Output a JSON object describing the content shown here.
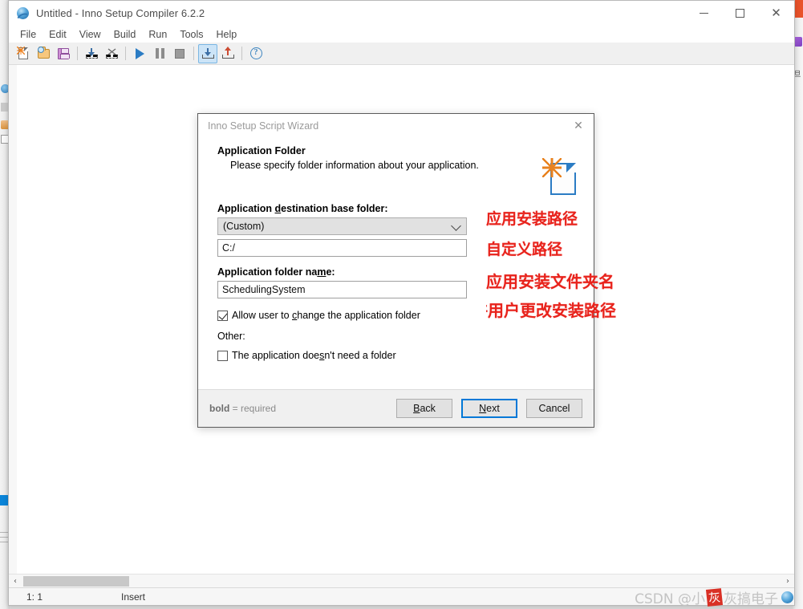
{
  "window": {
    "title": "Untitled - Inno Setup Compiler 6.2.2",
    "app_icon": "inno-setup-globe-icon",
    "minimize_label": "—",
    "maximize_label": "□",
    "close_label": "✕"
  },
  "menu": {
    "items": [
      {
        "label": "File"
      },
      {
        "label": "Edit"
      },
      {
        "label": "View"
      },
      {
        "label": "Build"
      },
      {
        "label": "Run"
      },
      {
        "label": "Tools"
      },
      {
        "label": "Help"
      }
    ]
  },
  "toolbar": {
    "buttons": [
      {
        "name": "new-file-icon"
      },
      {
        "name": "open-file-icon"
      },
      {
        "name": "save-file-icon"
      },
      {
        "name": "import-icon"
      },
      {
        "name": "close-file-icon"
      },
      {
        "name": "run-icon"
      },
      {
        "name": "pause-icon"
      },
      {
        "name": "stop-icon"
      },
      {
        "name": "compile-icon"
      },
      {
        "name": "publish-icon"
      },
      {
        "name": "help-icon"
      }
    ]
  },
  "statusbar": {
    "cursor_position": "1:  1",
    "insert_mode": "Insert"
  },
  "scrollbar": {
    "left_arrow": "‹",
    "right_arrow": "›"
  },
  "wizard": {
    "title": "Inno Setup Script Wizard",
    "close_label": "✕",
    "page_title": "Application Folder",
    "page_subtitle": "Please specify folder information about your application.",
    "icon": "new-script-document-icon",
    "fields": {
      "base_folder_label_pre": "Application ",
      "base_folder_label_accel": "d",
      "base_folder_label_post": "estination base folder:",
      "base_folder_value": "(Custom)",
      "custom_path_value": "C:/",
      "folder_name_label_pre": "Application folder na",
      "folder_name_label_accel": "m",
      "folder_name_label_post": "e:",
      "folder_name_value": "SchedulingSystem"
    },
    "checkboxes": {
      "allow_change_pre": "Allow user to ",
      "allow_change_accel": "c",
      "allow_change_post": "hange the application folder",
      "allow_change_checked": true,
      "other_label": "Other:",
      "no_folder_pre": "The application doe",
      "no_folder_accel": "s",
      "no_folder_post": "n't need a folder",
      "no_folder_checked": false
    },
    "footer": {
      "required_bold": "bold",
      "required_rest": " = required",
      "back_pre": "",
      "back_accel": "B",
      "back_post": "ack",
      "next_pre": "",
      "next_accel": "N",
      "next_post": "ext",
      "cancel_label": "Cancel"
    }
  },
  "annotations": [
    {
      "text": "应用安装路径",
      "meaning": "application install path"
    },
    {
      "text": "自定义路径",
      "meaning": "custom path"
    },
    {
      "text": "应用安装文件夹名",
      "meaning": "application install folder name"
    },
    {
      "text": "允许用户更改安装路径",
      "meaning": "allow user to change install path"
    }
  ],
  "watermark": {
    "prefix": "CSDN @小",
    "seal": "灰",
    "suffix": "灰搞电子"
  },
  "colors": {
    "accent": "#0078d7",
    "annotation_red": "#e8231c",
    "dialog_border": "#5c5c5c",
    "toolbar_bg": "#f0f0f0"
  }
}
